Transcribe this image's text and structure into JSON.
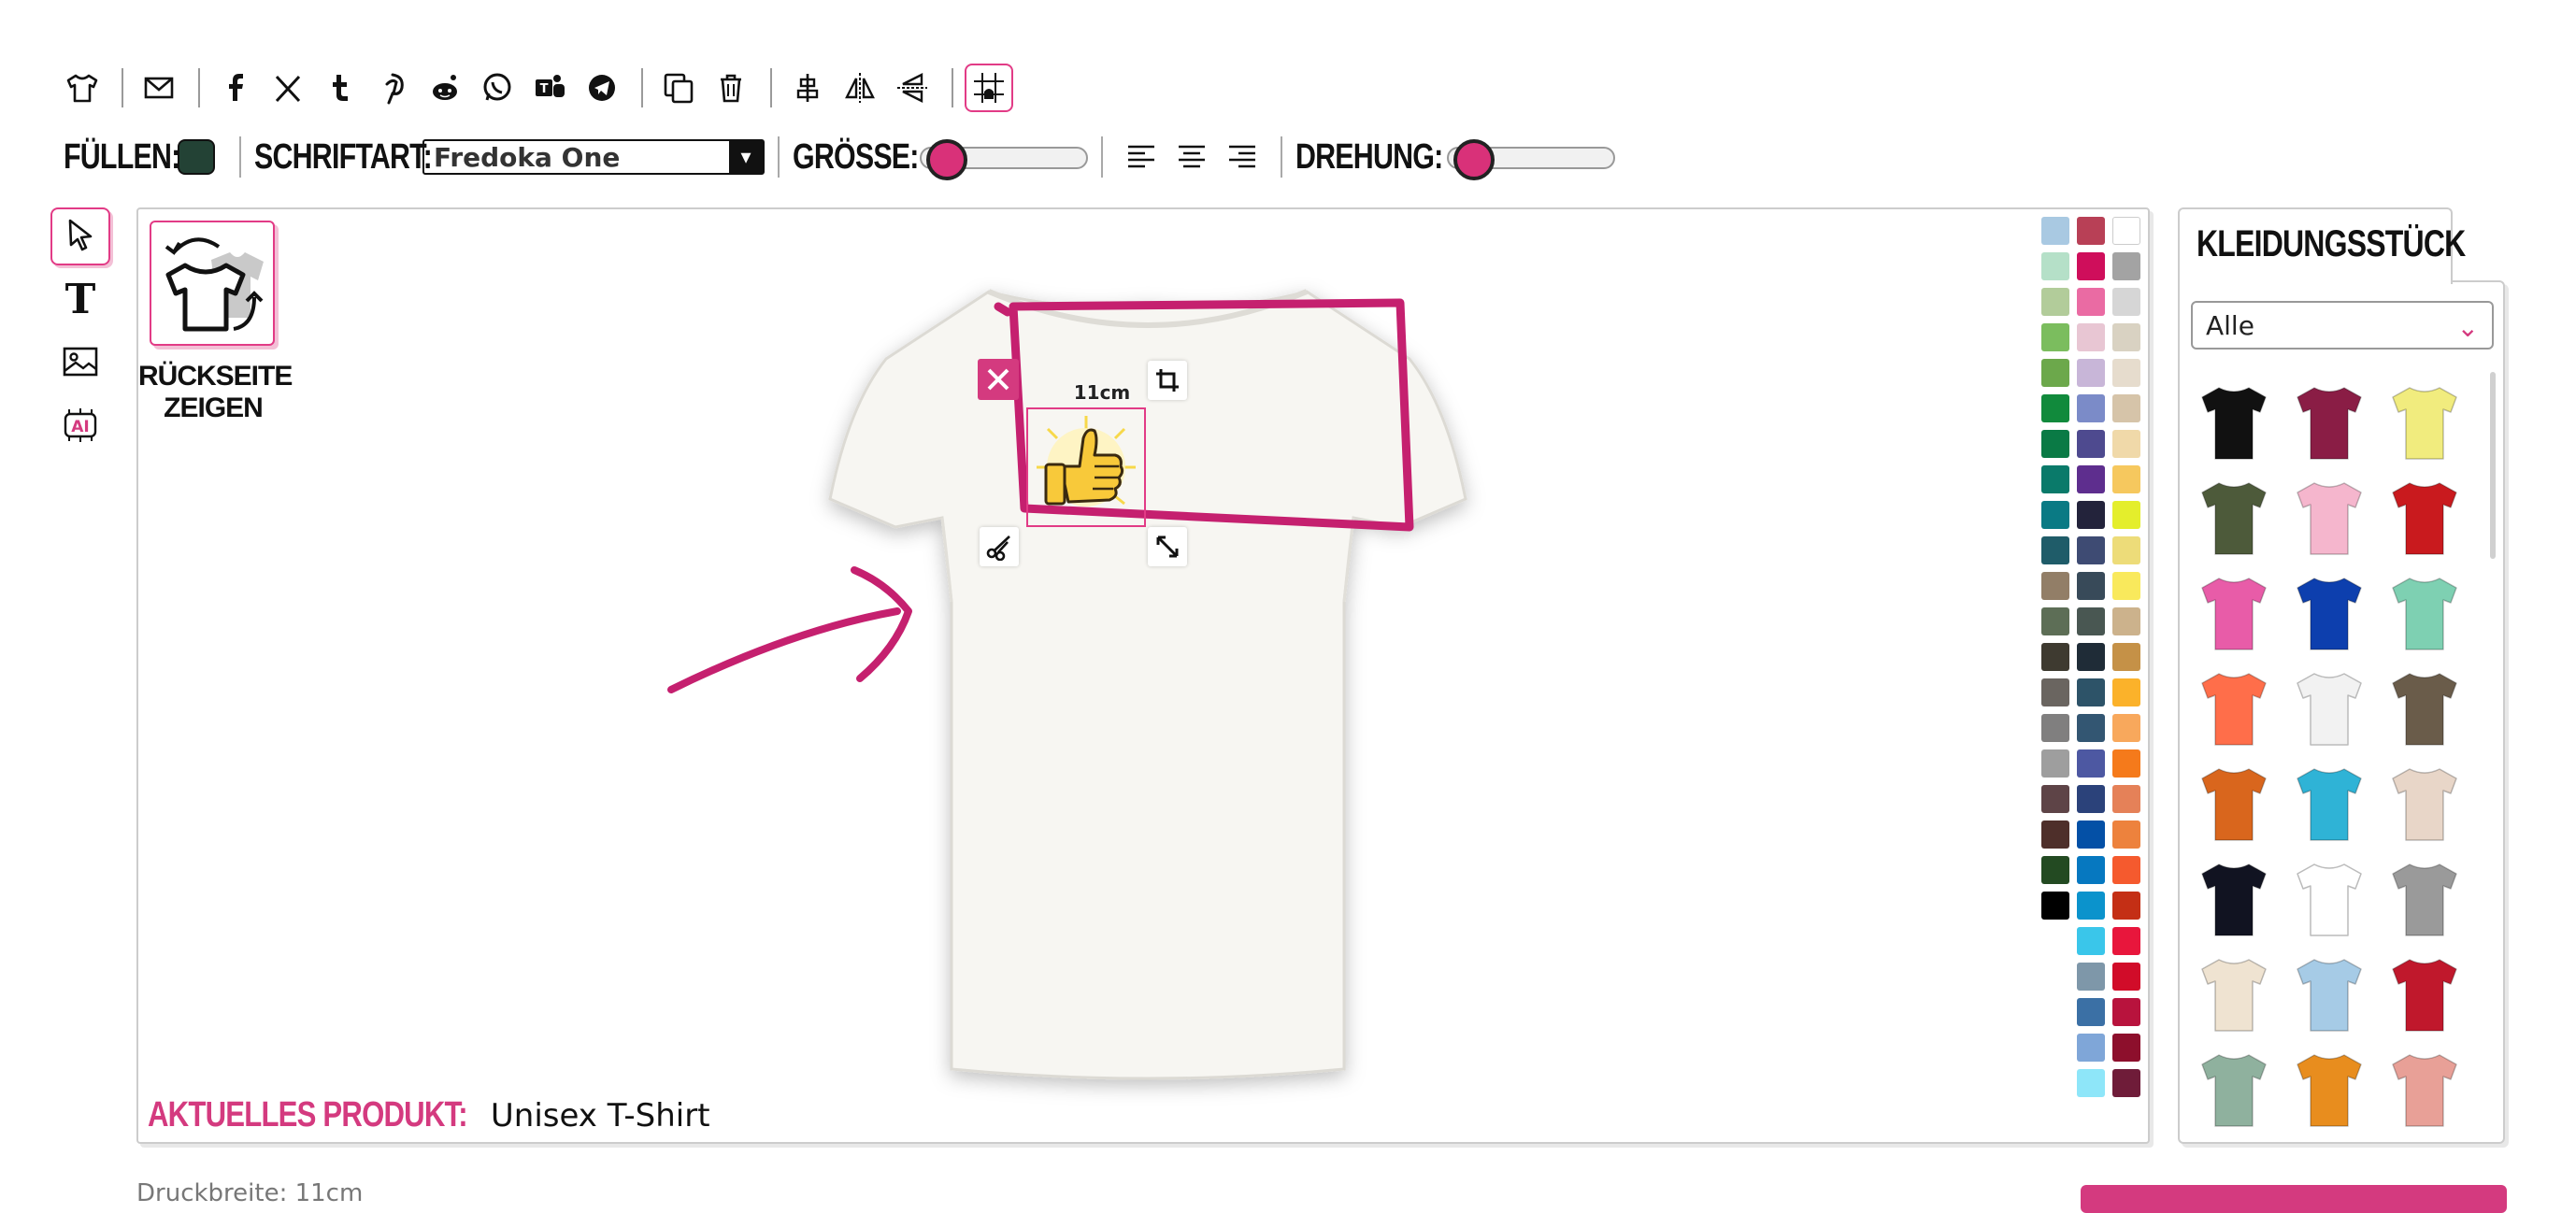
{
  "toolbar": {
    "items": [
      {
        "icon": "tshirt-icon"
      },
      {
        "icon": "mail-icon"
      },
      {
        "icon": "facebook-icon"
      },
      {
        "icon": "x-icon"
      },
      {
        "icon": "tumblr-icon"
      },
      {
        "icon": "pinterest-icon"
      },
      {
        "icon": "reddit-icon"
      },
      {
        "icon": "whatsapp-icon"
      },
      {
        "icon": "teams-icon"
      },
      {
        "icon": "telegram-icon"
      },
      {
        "icon": "duplicate-icon"
      },
      {
        "icon": "trash-icon"
      },
      {
        "icon": "align-center-icon"
      },
      {
        "icon": "flip-horizontal-icon"
      },
      {
        "icon": "flip-vertical-icon"
      },
      {
        "icon": "grid-icon"
      }
    ]
  },
  "format": {
    "fill_label": "FÜLLEN:",
    "fill_color": "#234235",
    "font_label": "SCHRIFTART:",
    "font_value": "Fredoka One",
    "size_label": "GRÖSSE:",
    "size_value": 0.05,
    "rotation_label": "DREHUNG:",
    "rotation_value": 0.05
  },
  "left_tools": [
    {
      "icon": "pointer-icon",
      "active": true
    },
    {
      "icon": "text-icon",
      "active": false
    },
    {
      "icon": "image-icon",
      "active": false
    },
    {
      "icon": "ai-icon",
      "active": false
    }
  ],
  "canvas": {
    "back_label_1": "RÜCKSEITE",
    "back_label_2": "ZEIGEN",
    "dimension_label": "11cm",
    "product_key": "AKTUELLES PRODUKT:",
    "product_value": "Unisex T-Shirt",
    "accent": "#c5206f"
  },
  "palette": [
    "#a9c9e2",
    "#b84056",
    "#ffffff",
    "#b5e0c8",
    "#cf0e5b",
    "#a3a3a3",
    "#b2cc9a",
    "#ea6ba3",
    "#d6d6d6",
    "#7bbd5e",
    "#e8c6d3",
    "#d9d2c2",
    "#6ca84b",
    "#c8b6d8",
    "#e6dccd",
    "#118a3c",
    "#7b8bc8",
    "#d6c4a9",
    "#0a7a45",
    "#4e4a8f",
    "#f0d9a9",
    "#0a7a6a",
    "#5e2e8e",
    "#f6c85e",
    "#0a7a84",
    "#23233b",
    "#e4ee2c",
    "#1f5c69",
    "#3e4b73",
    "#eddc79",
    "#927e67",
    "#384a59",
    "#f9e95c",
    "#5d6e56",
    "#495752",
    "#ccb28c",
    "#3e3a30",
    "#1f2c37",
    "#c59147",
    "#6a6560",
    "#2d5368",
    "#fbb22a",
    "#807f7f",
    "#335672",
    "#f8a85c",
    "#9e9e9e",
    "#4d58a2",
    "#f57a1b",
    "#5e4447",
    "#2b427a",
    "#e58158",
    "#4e2f2a",
    "#0450a6",
    "#ed823d",
    "#234a22",
    "#0678c0",
    "#f55a2e",
    "#000000",
    "#0b93cc",
    "#c42f15",
    null,
    "#3ac6ea",
    "#e8163c",
    null,
    "#7e97a9",
    "#d10c29",
    null,
    "#3b70a5",
    "#b8133d",
    null,
    "#7fa6d8",
    "#8d0f2c",
    null,
    "#8ee6f9",
    "#6f1c39"
  ],
  "garment_panel": {
    "tab_label": "KLEIDUNGSSTÜCK",
    "filter_value": "Alle",
    "items": [
      "#111111",
      "#8a1d45",
      "#f1ec7e",
      "#4d5a3a",
      "#f5b6cd",
      "#c91a1e",
      "#e85ca8",
      "#0d3fae",
      "#7ed0b2",
      "#ff6e4a",
      "#f2f2f2",
      "#6a5c4a",
      "#d9661d",
      "#2fb3d6",
      "#e8d6c8",
      "#111321",
      "#ffffff",
      "#9a9a9a",
      "#efe3d1",
      "#a6cbe6",
      "#c0182c",
      "#8fb19e",
      "#e88d1e",
      "#e8a097"
    ]
  },
  "footer": {
    "print_width": "Druckbreite: 11cm"
  }
}
